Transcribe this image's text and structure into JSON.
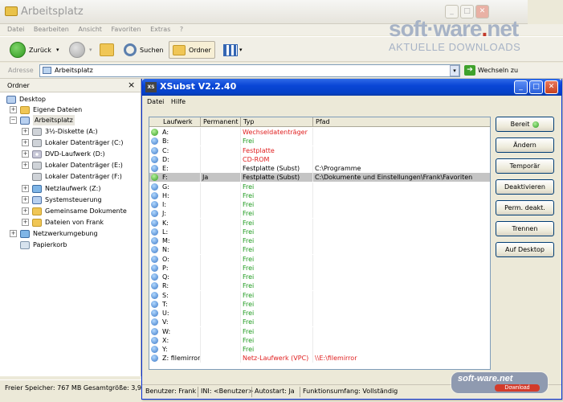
{
  "explorer": {
    "title": "Arbeitsplatz",
    "menu": [
      "Datei",
      "Bearbeiten",
      "Ansicht",
      "Favoriten",
      "Extras",
      "?"
    ],
    "toolbar": {
      "back_label": "Zurück",
      "search_label": "Suchen",
      "folder_label": "Ordner"
    },
    "address": {
      "label": "Adresse",
      "value": "Arbeitsplatz",
      "go_label": "Wechseln zu"
    },
    "folder_pane": {
      "title": "Ordner",
      "close": "×",
      "items": [
        {
          "label": "Desktop",
          "icon": "desktop-icon"
        },
        {
          "label": "Eigene Dateien",
          "icon": "folder-icon"
        },
        {
          "label": "Arbeitsplatz",
          "icon": "computer-icon"
        },
        {
          "label": "3½-Diskette (A:)",
          "icon": "floppy-icon"
        },
        {
          "label": "Lokaler Datenträger (C:)",
          "icon": "drive-icon"
        },
        {
          "label": "DVD-Laufwerk (D:)",
          "icon": "dvd-icon"
        },
        {
          "label": "Lokaler Datenträger (E:)",
          "icon": "drive-icon"
        },
        {
          "label": "Lokaler Datenträger (F:)",
          "icon": "drive-icon"
        },
        {
          "label": "Netzlaufwerk (Z:)",
          "icon": "network-drive-icon"
        },
        {
          "label": "Systemsteuerung",
          "icon": "control-panel-icon"
        },
        {
          "label": "Gemeinsame Dokumente",
          "icon": "folder-icon"
        },
        {
          "label": "Dateien von Frank",
          "icon": "folder-icon"
        },
        {
          "label": "Netzwerkumgebung",
          "icon": "network-icon"
        },
        {
          "label": "Papierkorb",
          "icon": "recycle-bin-icon"
        }
      ]
    },
    "status": "Freier Speicher: 767 MB Gesamtgröße: 3,90"
  },
  "brand": {
    "name_left": "soft·ware",
    "name_accent": ".",
    "name_right": "net",
    "tagline": "AKTUELLE DOWNLOADS"
  },
  "xsubst": {
    "title": "XSubst V2.2.40",
    "app_icon_text": "XS",
    "menu": [
      "Datei",
      "Hilfe"
    ],
    "columns": [
      "Laufwerk",
      "Permanent",
      "Typ",
      "Pfad"
    ],
    "rows": [
      {
        "drive": "A:",
        "permanent": "",
        "type": "Wechseldatenträger",
        "path": "",
        "color": "red"
      },
      {
        "drive": "B:",
        "permanent": "",
        "type": "Frei",
        "path": "",
        "color": "green"
      },
      {
        "drive": "C:",
        "permanent": "",
        "type": "Festplatte",
        "path": "",
        "color": "red"
      },
      {
        "drive": "D:",
        "permanent": "",
        "type": "CD-ROM",
        "path": "",
        "color": "red"
      },
      {
        "drive": "E:",
        "permanent": "",
        "type": "Festplatte (Subst)",
        "path": "C:\\Programme",
        "color": "black"
      },
      {
        "drive": "F:",
        "permanent": "Ja",
        "type": "Festplatte (Subst)",
        "path": "C:\\Dokumente und Einstellungen\\Frank\\Favoriten",
        "color": "black",
        "selected": true
      },
      {
        "drive": "G:",
        "permanent": "",
        "type": "Frei",
        "path": "",
        "color": "green"
      },
      {
        "drive": "H:",
        "permanent": "",
        "type": "Frei",
        "path": "",
        "color": "green"
      },
      {
        "drive": "I:",
        "permanent": "",
        "type": "Frei",
        "path": "",
        "color": "green"
      },
      {
        "drive": "J:",
        "permanent": "",
        "type": "Frei",
        "path": "",
        "color": "green"
      },
      {
        "drive": "K:",
        "permanent": "",
        "type": "Frei",
        "path": "",
        "color": "green"
      },
      {
        "drive": "L:",
        "permanent": "",
        "type": "Frei",
        "path": "",
        "color": "green"
      },
      {
        "drive": "M:",
        "permanent": "",
        "type": "Frei",
        "path": "",
        "color": "green"
      },
      {
        "drive": "N:",
        "permanent": "",
        "type": "Frei",
        "path": "",
        "color": "green"
      },
      {
        "drive": "O:",
        "permanent": "",
        "type": "Frei",
        "path": "",
        "color": "green"
      },
      {
        "drive": "P:",
        "permanent": "",
        "type": "Frei",
        "path": "",
        "color": "green"
      },
      {
        "drive": "Q:",
        "permanent": "",
        "type": "Frei",
        "path": "",
        "color": "green"
      },
      {
        "drive": "R:",
        "permanent": "",
        "type": "Frei",
        "path": "",
        "color": "green"
      },
      {
        "drive": "S:",
        "permanent": "",
        "type": "Frei",
        "path": "",
        "color": "green"
      },
      {
        "drive": "T:",
        "permanent": "",
        "type": "Frei",
        "path": "",
        "color": "green"
      },
      {
        "drive": "U:",
        "permanent": "",
        "type": "Frei",
        "path": "",
        "color": "green"
      },
      {
        "drive": "V:",
        "permanent": "",
        "type": "Frei",
        "path": "",
        "color": "green"
      },
      {
        "drive": "W:",
        "permanent": "",
        "type": "Frei",
        "path": "",
        "color": "green"
      },
      {
        "drive": "X:",
        "permanent": "",
        "type": "Frei",
        "path": "",
        "color": "green"
      },
      {
        "drive": "Y:",
        "permanent": "",
        "type": "Frei",
        "path": "",
        "color": "green"
      },
      {
        "drive": "Z: filemirror",
        "permanent": "",
        "type": "Netz-Laufwerk (VPC)",
        "path": "\\\\E:\\filemirror",
        "color": "red"
      }
    ],
    "buttons": {
      "ready": "Bereit",
      "change": "Ändern",
      "temporary": "Temporär",
      "deactivate": "Deaktivieren",
      "perm_deactivate": "Perm. deakt.",
      "disconnect": "Trennen",
      "to_desktop": "Auf Desktop"
    },
    "status": {
      "user": "Benutzer: Frank",
      "ini": "INI: <Benutzer>",
      "autostart": "Autostart: Ja",
      "scope": "Funktionsumfang: Vollständig"
    }
  },
  "watermark": {
    "text": "soft-ware.net",
    "sub": "Download"
  },
  "colors": {
    "xp_blue": "#0a46d6",
    "free_green": "#1e9a1e",
    "used_red": "#e01e1e"
  }
}
